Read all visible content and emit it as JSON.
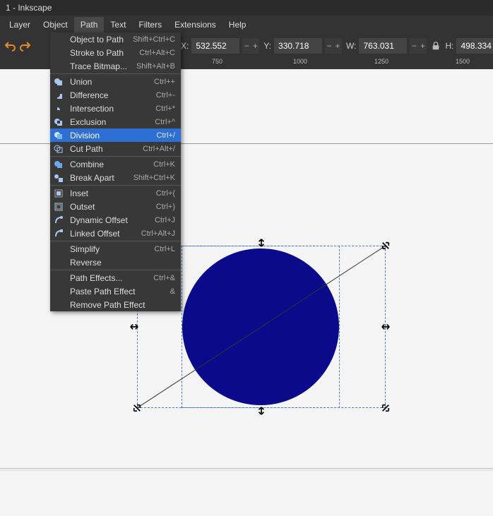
{
  "title": "1 - Inkscape",
  "menu": {
    "items": [
      "Layer",
      "Object",
      "Path",
      "Text",
      "Filters",
      "Extensions",
      "Help"
    ],
    "active": "Path"
  },
  "dropdown": {
    "groups": [
      [
        {
          "icon": "",
          "label": "Object to Path",
          "shortcut": "Shift+Ctrl+C"
        },
        {
          "icon": "",
          "label": "Stroke to Path",
          "shortcut": "Ctrl+Alt+C"
        },
        {
          "icon": "",
          "label": "Trace Bitmap...",
          "shortcut": "Shift+Alt+B"
        }
      ],
      [
        {
          "icon": "union",
          "label": "Union",
          "shortcut": "Ctrl++"
        },
        {
          "icon": "diff",
          "label": "Difference",
          "shortcut": "Ctrl+-"
        },
        {
          "icon": "inter",
          "label": "Intersection",
          "shortcut": "Ctrl+*"
        },
        {
          "icon": "excl",
          "label": "Exclusion",
          "shortcut": "Ctrl+^"
        },
        {
          "icon": "div",
          "label": "Division",
          "shortcut": "Ctrl+/",
          "selected": true
        },
        {
          "icon": "cut",
          "label": "Cut Path",
          "shortcut": "Ctrl+Alt+/"
        }
      ],
      [
        {
          "icon": "comb",
          "label": "Combine",
          "shortcut": "Ctrl+K"
        },
        {
          "icon": "break",
          "label": "Break Apart",
          "shortcut": "Shift+Ctrl+K"
        }
      ],
      [
        {
          "icon": "inset",
          "label": "Inset",
          "shortcut": "Ctrl+("
        },
        {
          "icon": "outset",
          "label": "Outset",
          "shortcut": "Ctrl+)"
        },
        {
          "icon": "dyn",
          "label": "Dynamic Offset",
          "shortcut": "Ctrl+J"
        },
        {
          "icon": "link",
          "label": "Linked Offset",
          "shortcut": "Ctrl+Alt+J"
        }
      ],
      [
        {
          "icon": "",
          "label": "Simplify",
          "shortcut": "Ctrl+L"
        },
        {
          "icon": "",
          "label": "Reverse",
          "shortcut": ""
        }
      ],
      [
        {
          "icon": "",
          "label": "Path Effects...",
          "shortcut": "Ctrl+&"
        },
        {
          "icon": "",
          "label": "Paste Path Effect",
          "shortcut": "&"
        },
        {
          "icon": "",
          "label": "Remove Path Effect",
          "shortcut": ""
        }
      ]
    ]
  },
  "coords": {
    "x_label": "X:",
    "x": "532.552",
    "y_label": "Y:",
    "y": "330.718",
    "w_label": "W:",
    "w": "763.031",
    "h_label": "H:",
    "h": "498.334"
  },
  "ruler": {
    "ticks": [
      "750",
      "1000",
      "1250",
      "1500"
    ]
  },
  "canvas": {
    "circle_color": "#0a0a8a"
  }
}
